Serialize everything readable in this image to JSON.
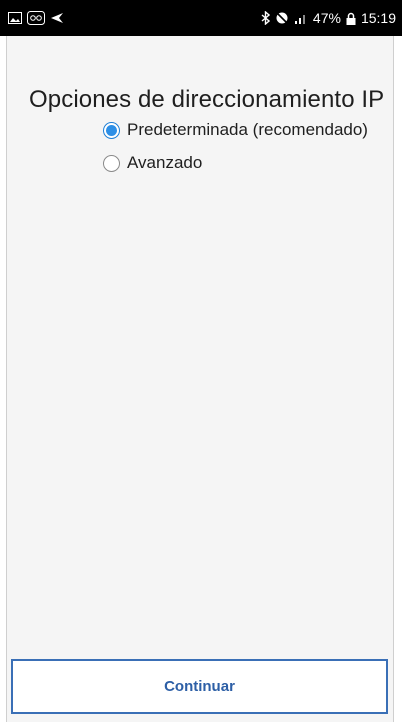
{
  "status_bar": {
    "left_icons": [
      "gallery-icon",
      "voicemail-icon",
      "send-icon"
    ],
    "right_icons": [
      "bluetooth-icon",
      "mute-icon",
      "signal-icon",
      "lock-icon"
    ],
    "battery": "47%",
    "time": "15:19"
  },
  "page": {
    "title": "Opciones de direccionamiento IP"
  },
  "options": [
    {
      "label": "Predeterminada (recomendado)",
      "selected": true
    },
    {
      "label": "Avanzado",
      "selected": false
    }
  ],
  "actions": {
    "continue_label": "Continuar"
  },
  "colors": {
    "accent": "#2d8fe6",
    "button_border": "#3a6fb6",
    "button_text": "#2d5fa6",
    "background": "#f5f5f5"
  }
}
